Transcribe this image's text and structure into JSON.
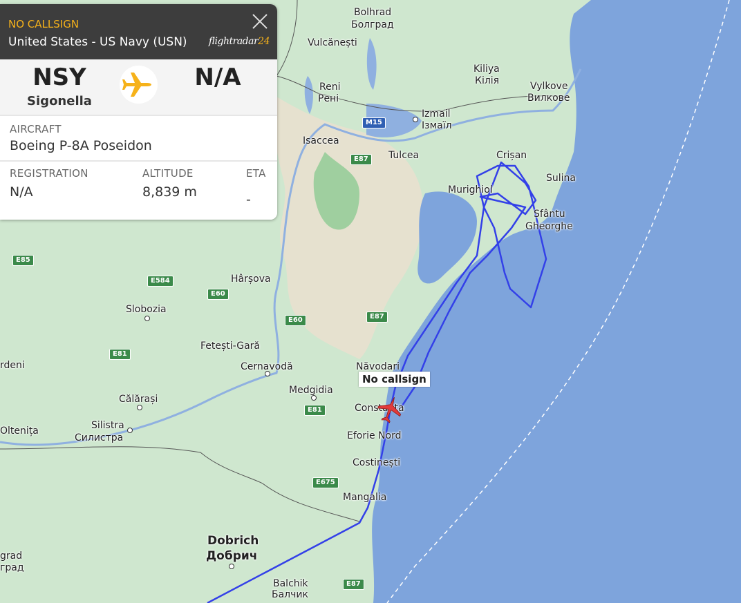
{
  "panel": {
    "callsign": "NO CALLSIGN",
    "operator": "United States - US Navy (USN)",
    "logo_text": "flightradar",
    "logo_num": "24",
    "origin_code": "NSY",
    "origin_name": "Sigonella",
    "destination_code": "N/A",
    "aircraft_label": "AIRCRAFT",
    "aircraft_value": "Boeing P-8A Poseidon",
    "registration_label": "REGISTRATION",
    "registration_value": "N/A",
    "altitude_label": "ALTITUDE",
    "altitude_value": "8,839 m",
    "eta_label": "ETA",
    "eta_value": "-"
  },
  "map": {
    "aircraft_label": "No callsign",
    "colors": {
      "land": "#cfe7cf",
      "sea": "#7ea4dc",
      "track": "#3340e8",
      "aircraft": "#e23b3b"
    },
    "places": [
      {
        "id": "bolhrad",
        "text": "Bolhrad"
      },
      {
        "id": "bolgrad",
        "text": "Болград"
      },
      {
        "id": "vulcanesti",
        "text": "Vulcănești"
      },
      {
        "id": "kiliya",
        "text": "Kiliya"
      },
      {
        "id": "kiliya-cyr",
        "text": "Кілія"
      },
      {
        "id": "vylkove",
        "text": "Vylkove"
      },
      {
        "id": "vylkove-cyr",
        "text": "Вилкове"
      },
      {
        "id": "reni",
        "text": "Reni"
      },
      {
        "id": "reni-cyr",
        "text": "Рені"
      },
      {
        "id": "izmail",
        "text": "Izmail"
      },
      {
        "id": "izmail-cyr",
        "text": "Ізмаїл"
      },
      {
        "id": "isaccea",
        "text": "Isaccea"
      },
      {
        "id": "tulcea",
        "text": "Tulcea"
      },
      {
        "id": "crisan",
        "text": "Crișan"
      },
      {
        "id": "sulina",
        "text": "Sulina"
      },
      {
        "id": "murighiol",
        "text": "Murighiol"
      },
      {
        "id": "sfantu",
        "text": "Sfântu"
      },
      {
        "id": "gheorghe",
        "text": "Gheorghe"
      },
      {
        "id": "harsova",
        "text": "Hârșova"
      },
      {
        "id": "slobozia",
        "text": "Slobozia"
      },
      {
        "id": "fetesti",
        "text": "Fetești-Gară"
      },
      {
        "id": "cernavoda",
        "text": "Cernavodă"
      },
      {
        "id": "rdeni",
        "text": "rdeni"
      },
      {
        "id": "navodari",
        "text": "Năvodari"
      },
      {
        "id": "medgidia",
        "text": "Medgidia"
      },
      {
        "id": "calarasi",
        "text": "Călărași"
      },
      {
        "id": "constanta",
        "text": "Constanța"
      },
      {
        "id": "silistra",
        "text": "Silistra"
      },
      {
        "id": "silistra-cyr",
        "text": "Силистра"
      },
      {
        "id": "oltenita",
        "text": "Oltenița"
      },
      {
        "id": "eforie",
        "text": "Eforie Nord"
      },
      {
        "id": "costinesti",
        "text": "Costinești"
      },
      {
        "id": "mangalia",
        "text": "Mangalia"
      },
      {
        "id": "dobrich",
        "text": "Dobrich"
      },
      {
        "id": "dobrich-cyr",
        "text": "Добрич"
      },
      {
        "id": "grad",
        "text": "grad"
      },
      {
        "id": "grad-cyr",
        "text": "град"
      },
      {
        "id": "balchik",
        "text": "Balchik"
      },
      {
        "id": "balchik-cyr",
        "text": "Балчик"
      }
    ],
    "roads": [
      "M15",
      "E87",
      "E85",
      "E584",
      "E60",
      "E60",
      "E87",
      "E81",
      "E81",
      "E675",
      "E87"
    ]
  }
}
